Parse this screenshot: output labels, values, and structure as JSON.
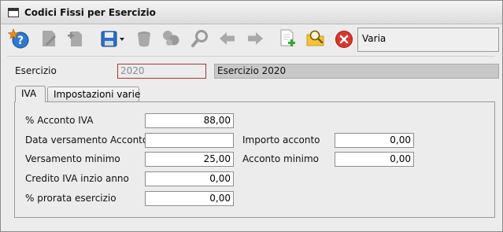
{
  "window": {
    "title": "Codici Fissi per Esercizio"
  },
  "toolbar": {
    "buttons": [
      {
        "name": "help-button",
        "icon": "help-star-icon"
      },
      {
        "name": "edit-button",
        "icon": "edit-document-icon"
      },
      {
        "name": "new-button",
        "icon": "new-document-icon"
      },
      {
        "name": "save-button",
        "icon": "floppy-disk-icon"
      },
      {
        "name": "delete-button",
        "icon": "trash-icon"
      },
      {
        "name": "copy-button",
        "icon": "copy-icon"
      },
      {
        "name": "search-button",
        "icon": "magnifier-icon"
      },
      {
        "name": "previous-button",
        "icon": "arrow-left-icon"
      },
      {
        "name": "next-button",
        "icon": "arrow-right-icon"
      },
      {
        "name": "add-document-button",
        "icon": "document-plus-icon"
      },
      {
        "name": "find-user-button",
        "icon": "folder-search-icon"
      },
      {
        "name": "close-button",
        "icon": "close-icon"
      }
    ],
    "mode_label": "Varia"
  },
  "esercizio": {
    "label": "Esercizio",
    "value": "2020",
    "description": "Esercizio 2020"
  },
  "tabs": [
    {
      "label": "IVA",
      "active": true
    },
    {
      "label": "Impostazioni varie",
      "active": false
    }
  ],
  "iva": {
    "acconto_label": "% Acconto IVA",
    "acconto_value": "88,00",
    "data_versamento_label": "Data versamento Acconto",
    "data_versamento_value": "",
    "importo_acconto_label": "Importo acconto",
    "importo_acconto_value": "0,00",
    "versamento_minimo_label": "Versamento minimo",
    "versamento_minimo_value": "25,00",
    "acconto_minimo_label": "Acconto minimo",
    "acconto_minimo_value": "0,00",
    "credito_label": "Credito IVA inzio anno",
    "credito_value": "0,00",
    "prorata_label": "% prorata esercizio",
    "prorata_value": "0,00"
  },
  "colors": {
    "window_bg": "#ececec",
    "error_border": "#b23030",
    "close_red": "#d9362b",
    "help_blue": "#2b7bd4",
    "save_blue": "#2a6fc9"
  }
}
